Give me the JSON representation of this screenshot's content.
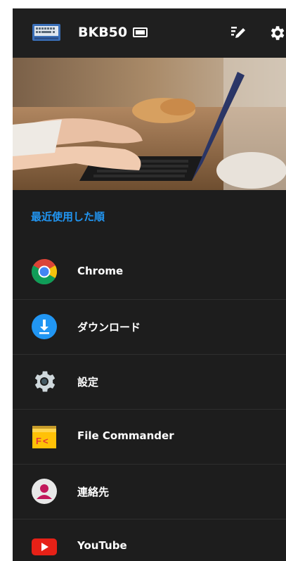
{
  "header": {
    "title": "BKB50"
  },
  "section": {
    "title": "最近使用した順"
  },
  "apps": [
    {
      "label": "Chrome",
      "icon": "chrome-icon"
    },
    {
      "label": "ダウンロード",
      "icon": "download-icon"
    },
    {
      "label": "設定",
      "icon": "settings-gear-icon"
    },
    {
      "label": "File Commander",
      "icon": "file-commander-icon"
    },
    {
      "label": "連絡先",
      "icon": "contacts-icon"
    },
    {
      "label": "YouTube",
      "icon": "youtube-icon"
    }
  ],
  "colors": {
    "background": "#1d1d1d",
    "accent": "#2196f3",
    "text": "#ffffff"
  }
}
